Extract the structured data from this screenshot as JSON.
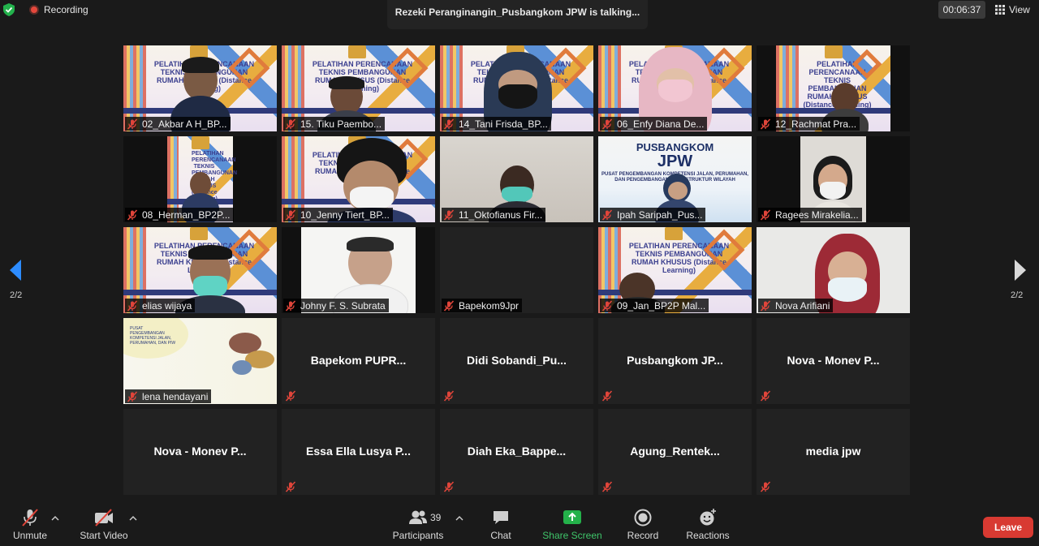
{
  "top_bar": {
    "recording_label": "Recording",
    "talking_banner": "Rezeki Peranginangin_Pusbangkom JPW is talking...",
    "timer": "00:06:37",
    "view_label": "View"
  },
  "pagination": {
    "left_page": "2/2",
    "right_page": "2/2"
  },
  "banner_text": {
    "title": "PELATIHAN PERENCANAAN TEKNIS PEMBANGUNAN RUMAH KHUSUS (Distance Learning)"
  },
  "pusbangkom_slide": {
    "line1": "PUSBANGKOM",
    "line2": "JPW",
    "line3": "PUSAT PENGEMBANGAN KOMPETENSI JALAN, PERUMAHAN, DAN PENGEMBANGAN INFRASTRUKTUR WILAYAH"
  },
  "lena_slide": {
    "text": "PUSAT PENGEMBANGAN KOMPETENSI JALAN, PERUMAHAN, DAN PIW"
  },
  "participants": [
    {
      "name": "02_Akbar A H_BP..."
    },
    {
      "name": "15. Tiku Paembo..."
    },
    {
      "name": "14_Tani Frisda_BP..."
    },
    {
      "name": "06_Enfy Diana De..."
    },
    {
      "name": "12_Rachmat Pra..."
    },
    {
      "name": "08_Herman_BP2P..."
    },
    {
      "name": "10_Jenny Tiert_BP..."
    },
    {
      "name": "11_Oktofianus Fir..."
    },
    {
      "name": "Ipah Saripah_Pus..."
    },
    {
      "name": "Ragees Mirakelia..."
    },
    {
      "name": "elias wijaya"
    },
    {
      "name": "Johny F. S. Subrata"
    },
    {
      "name": "Bapekom9Jpr"
    },
    {
      "name": "09_Jan_BP2P Mal..."
    },
    {
      "name": "Nova Arifiani"
    },
    {
      "name": "lena hendayani"
    },
    {
      "name": "Bapekom  PUPR..."
    },
    {
      "name": "Didi  Sobandi_Pu..."
    },
    {
      "name": "Pusbangkom  JP..."
    },
    {
      "name": "Nova - Monev  P..."
    },
    {
      "name": "Nova - Monev  P..."
    },
    {
      "name": "Essa Ella Lusya P..."
    },
    {
      "name": "Diah  Eka_Bappe..."
    },
    {
      "name": "Agung_Rentek..."
    },
    {
      "name": "media jpw"
    }
  ],
  "toolbar": {
    "unmute": "Unmute",
    "start_video": "Start Video",
    "participants": "Participants",
    "participant_count": "39",
    "chat": "Chat",
    "share_screen": "Share Screen",
    "record": "Record",
    "reactions": "Reactions",
    "leave": "Leave"
  },
  "colors": {
    "background": "#1a1a1a",
    "tile": "#222222",
    "accent_blue": "#2d8cff",
    "share_green": "#24b14a",
    "muted_red": "#e0453a",
    "leave_red": "#d83a32"
  }
}
